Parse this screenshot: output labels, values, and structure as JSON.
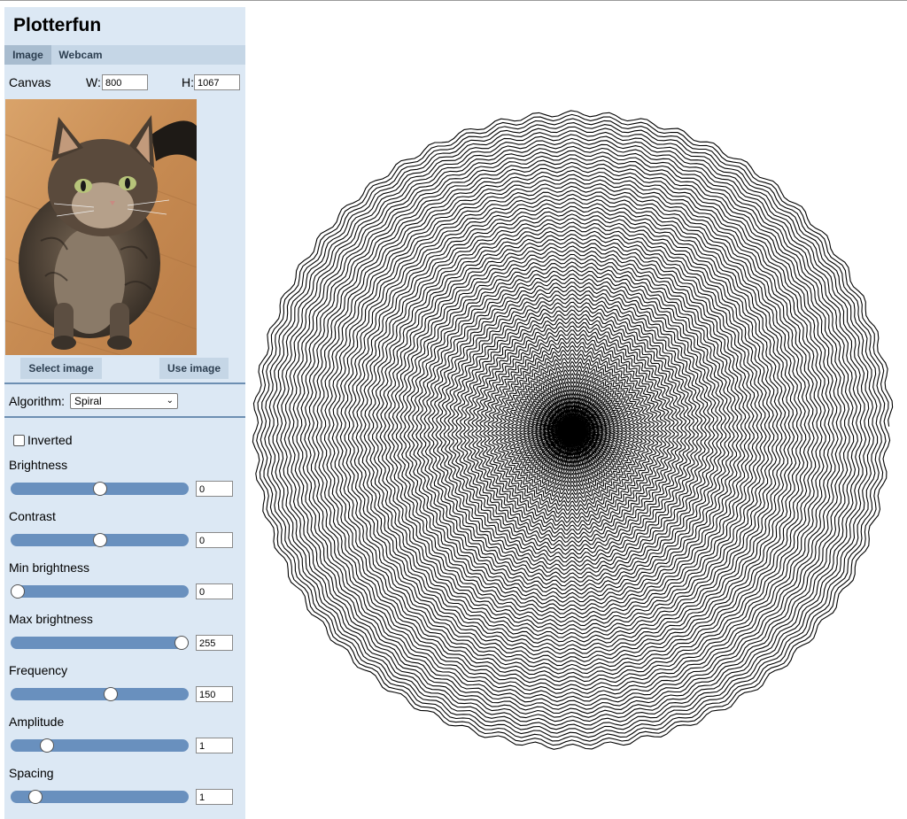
{
  "app": {
    "title": "Plotterfun"
  },
  "tabs": [
    {
      "label": "Image",
      "active": true
    },
    {
      "label": "Webcam",
      "active": false
    }
  ],
  "canvas": {
    "label": "Canvas",
    "w_label": "W:",
    "w_value": "800",
    "h_label": "H:",
    "h_value": "1067"
  },
  "image_buttons": {
    "select_label": "Select image",
    "use_label": "Use image"
  },
  "algorithm": {
    "label": "Algorithm:",
    "selected": "Spiral"
  },
  "inverted": {
    "label": "Inverted",
    "checked": false
  },
  "sliders": [
    {
      "label": "Brightness",
      "value": "0",
      "fraction": 0.5
    },
    {
      "label": "Contrast",
      "value": "0",
      "fraction": 0.5
    },
    {
      "label": "Min brightness",
      "value": "0",
      "fraction": 0.0
    },
    {
      "label": "Max brightness",
      "value": "255",
      "fraction": 1.0
    },
    {
      "label": "Frequency",
      "value": "150",
      "fraction": 0.57
    },
    {
      "label": "Amplitude",
      "value": "1",
      "fraction": 0.18
    },
    {
      "label": "Spacing",
      "value": "1",
      "fraction": 0.11
    }
  ],
  "colors": {
    "panel": "#dce8f4",
    "tabbar": "#c5d6e6",
    "active_tab": "#a8bccf",
    "slider_track": "#6990be",
    "divider": "#6d8fb2"
  },
  "icons": {
    "select_arrow": "chevron-down-icon"
  }
}
